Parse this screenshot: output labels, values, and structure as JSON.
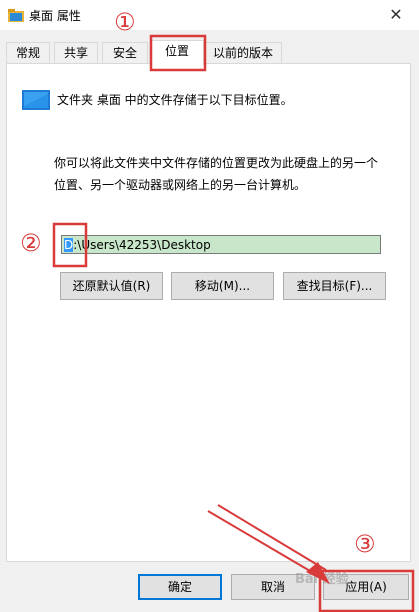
{
  "window": {
    "title": "桌面 属性",
    "close_glyph": "✕"
  },
  "tabs": [
    {
      "label": "常规"
    },
    {
      "label": "共享"
    },
    {
      "label": "安全"
    },
    {
      "label": "位置",
      "active": true
    },
    {
      "label": "以前的版本"
    }
  ],
  "location_tab": {
    "header": "文件夹 桌面 中的文件存储于以下目标位置。",
    "description_line1": "你可以将此文件夹中文件存储的位置更改为此硬盘上的另一个",
    "description_line2": "位置、另一个驱动器或网络上的另一台计算机。",
    "path_selected_char": "D",
    "path_rest": ":\\Users\\42253\\Desktop",
    "buttons": {
      "restore_default": "还原默认值(R)",
      "move": "移动(M)...",
      "find_target": "查找目标(F)..."
    }
  },
  "footer": {
    "ok": "确定",
    "cancel": "取消",
    "apply": "应用(A)"
  },
  "annotations": {
    "step1": "①",
    "step2": "②",
    "step3": "③",
    "color": "#d93a3a"
  },
  "watermark": "Bai 经验"
}
